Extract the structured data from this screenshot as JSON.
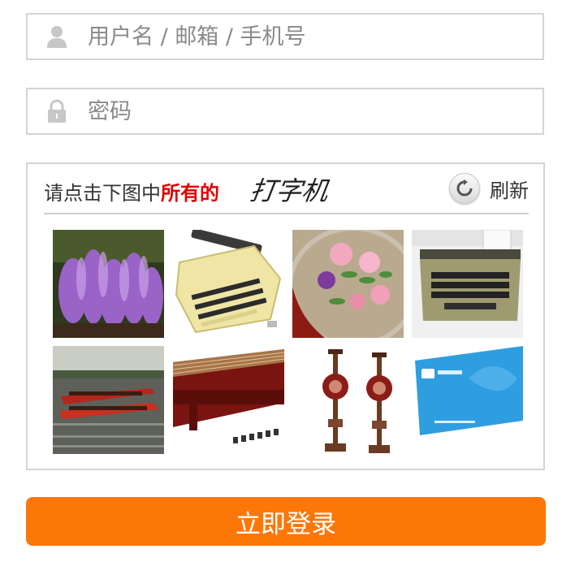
{
  "login_form": {
    "username": {
      "placeholder": "用户名 / 邮箱 / 手机号",
      "value": "",
      "icon": "user-icon"
    },
    "password": {
      "placeholder": "密码",
      "value": "",
      "icon": "lock-icon"
    },
    "submit_label": "立即登录",
    "accent_color": "#fd7708"
  },
  "captcha": {
    "prompt_prefix": "请点击下图中",
    "prompt_emphasis": "所有的",
    "target_word": "打字机",
    "refresh_label": "刷新",
    "refresh_icon": "refresh-icon",
    "tiles": [
      {
        "subject": "purple-coral-mushroom"
      },
      {
        "subject": "cream-typewriter"
      },
      {
        "subject": "floral-embroidery"
      },
      {
        "subject": "olive-typewriter"
      },
      {
        "subject": "dragon-boat-race"
      },
      {
        "subject": "red-wooden-guzheng"
      },
      {
        "subject": "ornate-candlesticks"
      },
      {
        "subject": "blue-card"
      }
    ]
  }
}
